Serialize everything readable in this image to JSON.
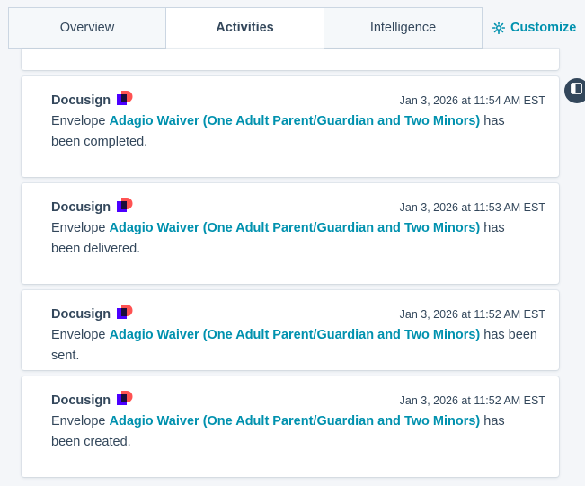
{
  "tabs": [
    {
      "label": "Overview",
      "active": false
    },
    {
      "label": "Activities",
      "active": true
    },
    {
      "label": "Intelligence",
      "active": false
    }
  ],
  "customize": {
    "label": "Customize",
    "icon": "gear-icon"
  },
  "colors": {
    "accent": "#0091ae",
    "text": "#33475b",
    "border": "#cbd6e2",
    "background": "#f4f6f9",
    "logo_red": "#ff5252",
    "logo_purple": "#4c00ff"
  },
  "activities": [
    {
      "source": "Docusign",
      "timestamp": "Jan 3, 2026 at 11:54 AM EST",
      "prefix": "Envelope ",
      "envelope": "Adagio Waiver (One Adult Parent/Guardian and Two Minors)",
      "suffix": " has been completed."
    },
    {
      "source": "Docusign",
      "timestamp": "Jan 3, 2026 at 11:53 AM EST",
      "prefix": "Envelope ",
      "envelope": "Adagio Waiver (One Adult Parent/Guardian and Two Minors)",
      "suffix": " has been delivered."
    },
    {
      "source": "Docusign",
      "timestamp": "Jan 3, 2026 at 11:52 AM EST",
      "prefix": "Envelope ",
      "envelope": "Adagio Waiver (One Adult Parent/Guardian and Two Minors)",
      "suffix": " has been sent."
    },
    {
      "source": "Docusign",
      "timestamp": "Jan 3, 2026 at 11:52 AM EST",
      "prefix": "Envelope ",
      "envelope": "Adagio Waiver (One Adult Parent/Guardian and Two Minors)",
      "suffix": " has been created."
    }
  ]
}
